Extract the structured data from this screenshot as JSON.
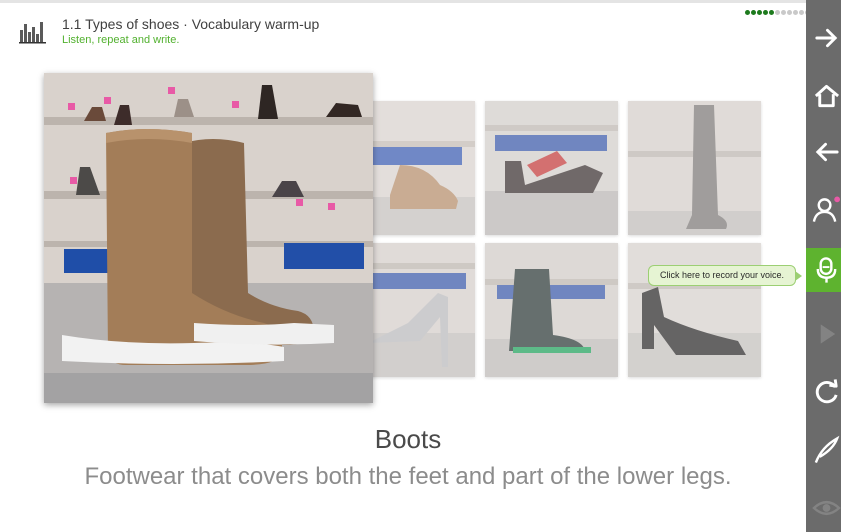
{
  "header": {
    "title": "1.1 Types of shoes · Vocabulary warm-up",
    "subtitle": "Listen, repeat and write.",
    "icon": "audio-levels-icon",
    "progress": {
      "total": 11,
      "completed": 5,
      "active_color": "#1d7a1d",
      "inactive_color": "#c9c9c9"
    }
  },
  "main_image": {
    "subject": "boots",
    "alt": "Pair of tan suede boots on a store shelf"
  },
  "thumbnails": [
    {
      "subject": "clogs"
    },
    {
      "subject": "platform sandals"
    },
    {
      "subject": "knee-high boots"
    },
    {
      "subject": "stilettos"
    },
    {
      "subject": "wellington boots"
    },
    {
      "subject": "pumps"
    }
  ],
  "tooltip": {
    "text": "Click here to record your voice."
  },
  "caption": {
    "word": "Boots",
    "definition": "Footwear that covers both the feet and part of the lower legs."
  },
  "toolbar": {
    "background": "#6b6b6b",
    "active_color": "#5eb32f",
    "tools": [
      {
        "icon": "arrow-right-icon",
        "label": "Next"
      },
      {
        "icon": "home-icon",
        "label": "Home"
      },
      {
        "icon": "arrow-left-icon",
        "label": "Back"
      },
      {
        "icon": "users-icon",
        "label": "Participants"
      },
      {
        "icon": "microphone-icon",
        "label": "Record"
      },
      {
        "icon": "play-icon",
        "label": "Play"
      },
      {
        "icon": "refresh-icon",
        "label": "Restart"
      },
      {
        "icon": "quill-icon",
        "label": "Write"
      },
      {
        "icon": "eye-icon",
        "label": "View"
      }
    ]
  }
}
